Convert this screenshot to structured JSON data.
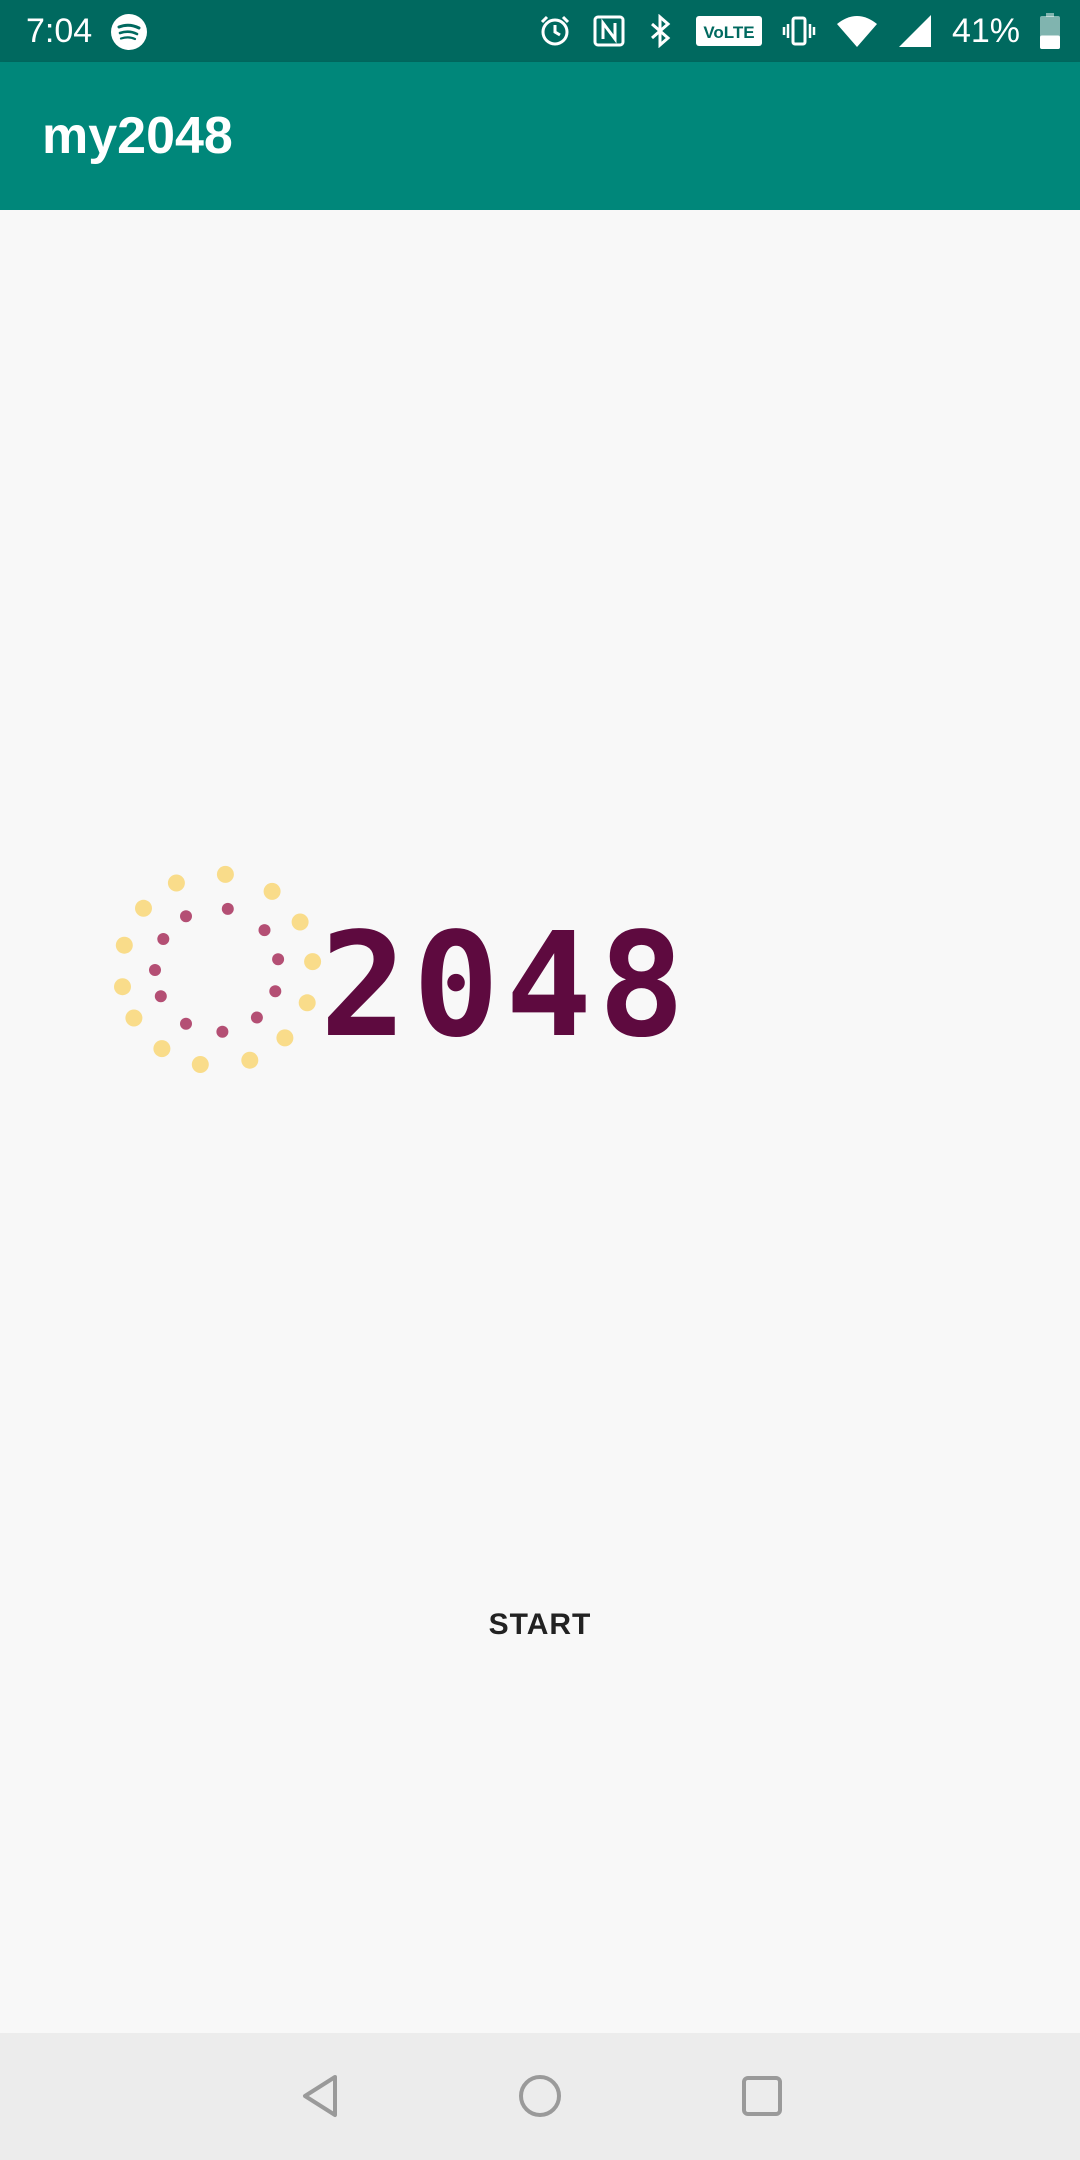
{
  "status_bar": {
    "time": "7:04",
    "battery_percent": "41%",
    "icons": [
      "spotify-icon",
      "alarm-icon",
      "nfc-icon",
      "bluetooth-icon",
      "volte-icon",
      "vibrate-icon",
      "wifi-icon",
      "signal-icon",
      "battery-icon"
    ],
    "volte_label": "VoLTE",
    "battery_level": 0.41
  },
  "app_bar": {
    "title": "my2048"
  },
  "logo": {
    "text": "2048",
    "text_color": "#5e0a3f",
    "outer_dot_color": "#f9dc8a",
    "inner_dot_color": "#b44f74"
  },
  "main": {
    "start_label": "START"
  },
  "nav_bar": {
    "buttons": [
      "back-icon",
      "home-icon",
      "recents-icon"
    ]
  },
  "colors": {
    "status_bar": "#00695f",
    "app_bar": "#00877a",
    "background": "#f8f8f8",
    "nav_bar": "#ececec"
  }
}
